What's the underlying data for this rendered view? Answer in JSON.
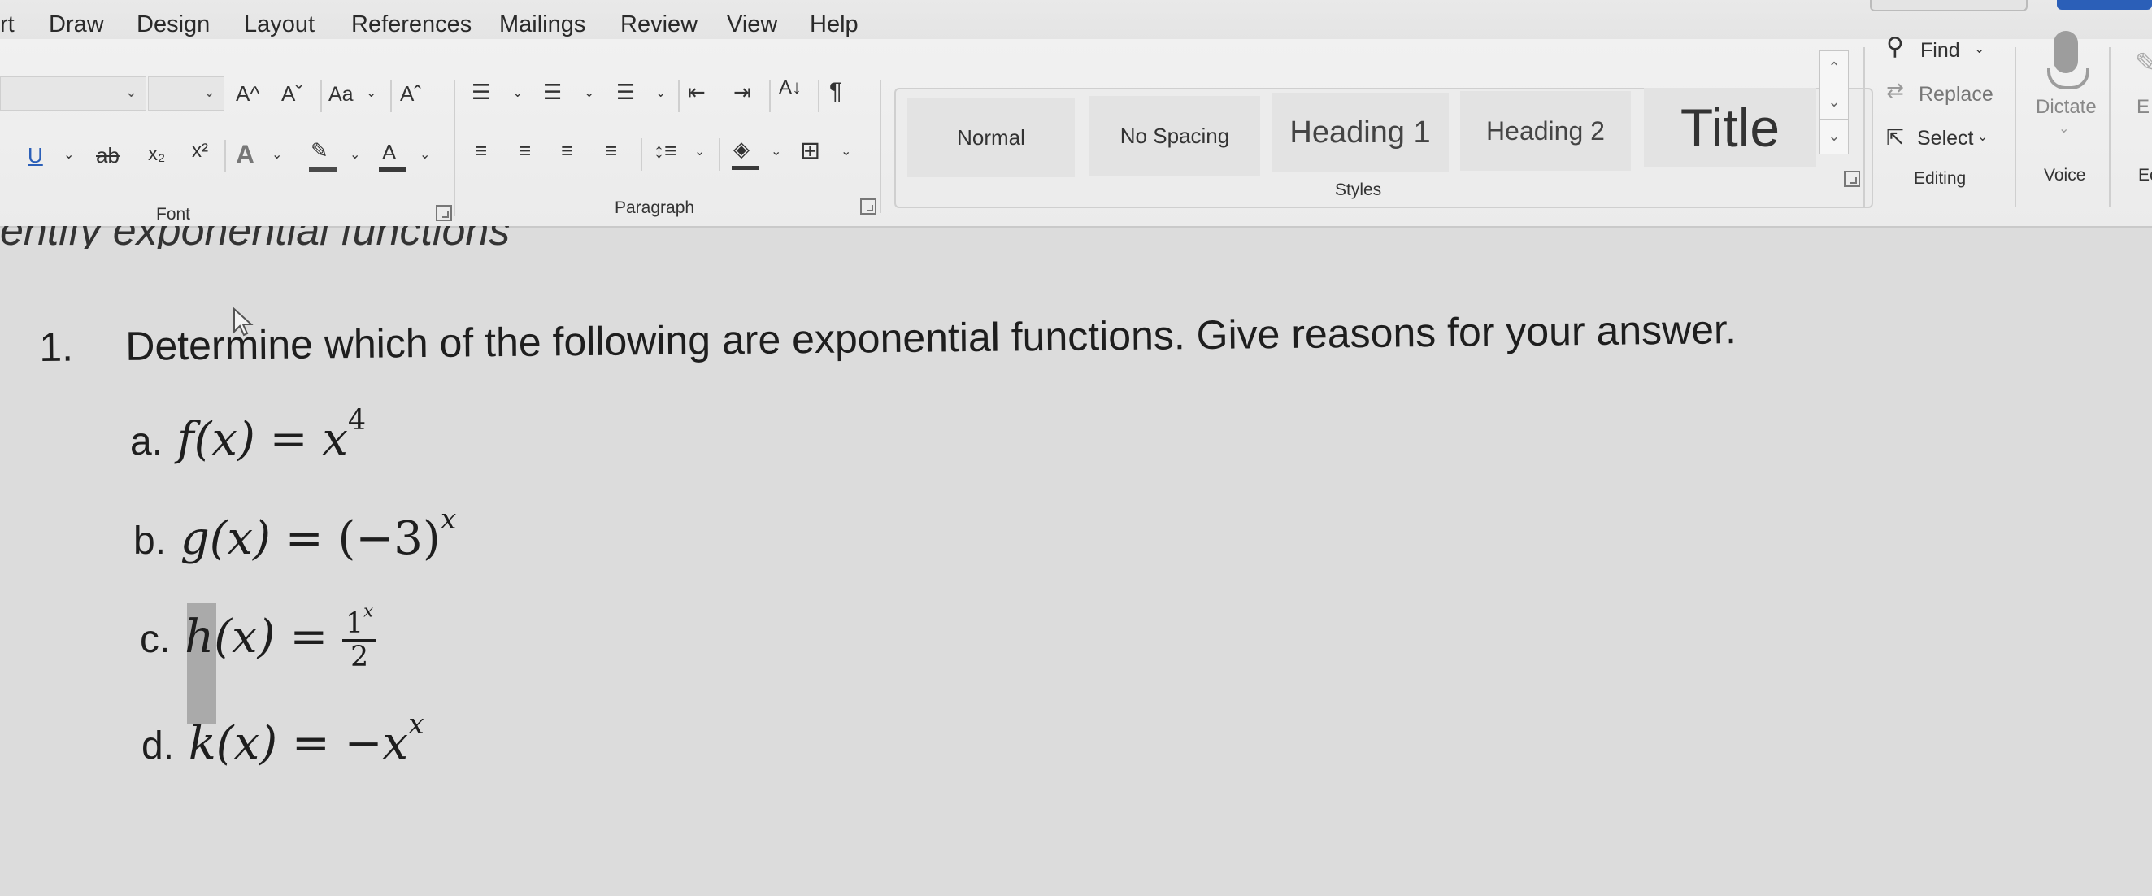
{
  "menu": {
    "tabs": [
      "rt",
      "Draw",
      "Design",
      "Layout",
      "References",
      "Mailings",
      "Review",
      "View",
      "Help"
    ]
  },
  "ribbon": {
    "font": {
      "group_label": "Font",
      "grow_font": "A^",
      "shrink_font": "Aˇ",
      "change_case": "Aa",
      "subscript": "x₂",
      "superscript": "x²",
      "font_color_letter": "A",
      "underline": "U",
      "strike": "ab"
    },
    "paragraph": {
      "group_label": "Paragraph",
      "pilcrow": "¶"
    },
    "styles": {
      "group_label": "Styles",
      "items": [
        "Normal",
        "No Spacing",
        "Heading 1",
        "Heading 2",
        "Title"
      ]
    },
    "editing": {
      "group_label": "Editing",
      "find": "Find",
      "replace": "Replace",
      "select": "Select"
    },
    "voice": {
      "group_label": "Voice",
      "dictate": "Dictate"
    },
    "editor": {
      "partial_label": "E",
      "partial_group": "Ec"
    }
  },
  "document": {
    "cut_heading": "entify exponential functions",
    "question_number": "1.",
    "question_text": "Determine which of the following are exponential functions. Give reasons for your answer.",
    "items": [
      {
        "letter": "a.",
        "lhs": "f(x)",
        "eq": "=",
        "base": "x",
        "exp": "4"
      },
      {
        "letter": "b.",
        "lhs": "g(x)",
        "eq": "=",
        "base": "(−3)",
        "exp": "x"
      },
      {
        "letter": "c.",
        "lhs": "h(x)",
        "eq": "=",
        "num": "1",
        "num_exp": "x",
        "den": "2"
      },
      {
        "letter": "d.",
        "lhs": "k(x)",
        "eq": "=",
        "base": "−x",
        "exp": "x"
      }
    ]
  }
}
